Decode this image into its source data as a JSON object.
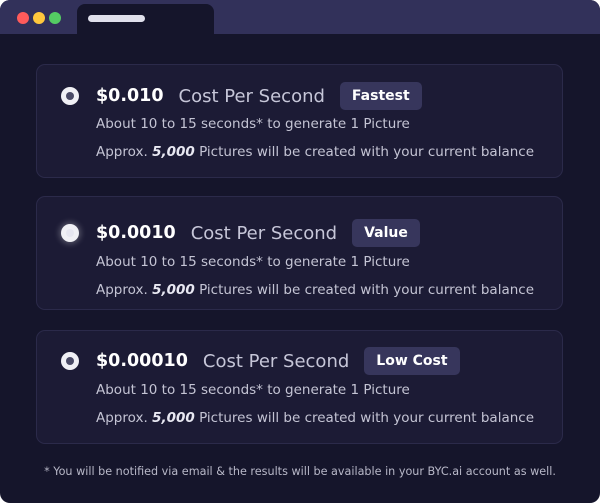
{
  "window": {
    "traffic_lights": [
      {
        "name": "close",
        "color": "#ff5b5b"
      },
      {
        "name": "minimize",
        "color": "#ffc83d"
      },
      {
        "name": "maximize",
        "color": "#54cc63"
      }
    ]
  },
  "options": [
    {
      "price": "$0.010",
      "price_label": "Cost Per Second",
      "badge": "Fastest",
      "time_text": "About 10 to 15 seconds* to generate 1 Picture",
      "approx_prefix": "Approx.",
      "approx_count": "5,000",
      "approx_suffix": "Pictures will be created with your current balance",
      "selected": false
    },
    {
      "price": "$0.0010",
      "price_label": "Cost Per Second",
      "badge": "Value",
      "time_text": "About 10 to 15 seconds* to generate 1 Picture",
      "approx_prefix": "Approx.",
      "approx_count": "5,000",
      "approx_suffix": "Pictures will be created with your current balance",
      "selected": true
    },
    {
      "price": "$0.00010",
      "price_label": "Cost Per Second",
      "badge": "Low Cost",
      "time_text": "About 10 to 15 seconds* to generate 1 Picture",
      "approx_prefix": "Approx.",
      "approx_count": "5,000",
      "approx_suffix": "Pictures will be created with your current balance",
      "selected": false
    }
  ],
  "footnote": "* You will be notified via email & the results will be available in your BYC.ai account as well.",
  "colors": {
    "background": "#15152b",
    "titlebar": "#32315a",
    "card": "#1c1b35",
    "badge": "#37365c"
  }
}
